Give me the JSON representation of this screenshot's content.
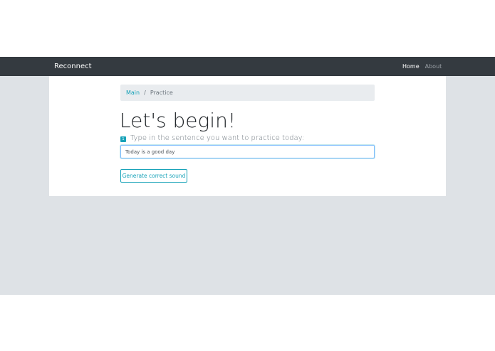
{
  "navbar": {
    "brand": "Reconnect",
    "links": [
      {
        "label": "Home",
        "active": true
      },
      {
        "label": "About",
        "active": false
      }
    ]
  },
  "breadcrumb": {
    "items": [
      "Main",
      "Practice"
    ],
    "separator": "/"
  },
  "main": {
    "title": "Let's begin!",
    "step": {
      "number": "1",
      "text": "Type in the sentence you want to practice today:"
    },
    "sentence_input": {
      "value": "Today is a good day"
    },
    "generate_button_label": "Generate correct sound"
  },
  "colors": {
    "navbar_bg": "#343a40",
    "page_bg": "#dee2e6",
    "accent": "#17a2b8"
  }
}
